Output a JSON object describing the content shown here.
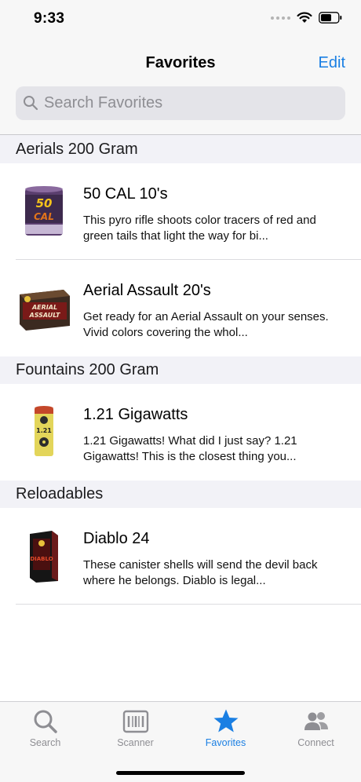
{
  "status": {
    "time": "9:33"
  },
  "nav": {
    "title": "Favorites",
    "edit_label": "Edit"
  },
  "search": {
    "placeholder": "Search Favorites"
  },
  "sections": [
    {
      "header": "Aerials 200 Gram",
      "items": [
        {
          "title": "50 CAL 10's",
          "description": "This pyro rifle shoots color tracers of red and green tails that light the way for bi...",
          "thumb_text": "50 CAL"
        },
        {
          "title": "Aerial Assault 20's",
          "description": "Get ready for an Aerial Assault on your senses. Vivid colors covering the whol...",
          "thumb_text": "AERIAL ASSAULT"
        }
      ]
    },
    {
      "header": "Fountains 200 Gram",
      "items": [
        {
          "title": "1.21 Gigawatts",
          "description": "1.21 Gigawatts! What did I just say? 1.21 Gigawatts! This is the closest thing you...",
          "thumb_text": "1.21"
        }
      ]
    },
    {
      "header": "Reloadables",
      "items": [
        {
          "title": "Diablo 24",
          "description": "These canister shells will send the devil back where he belongs.  Diablo is legal...",
          "thumb_text": "DIABLO"
        }
      ]
    }
  ],
  "tabs": [
    {
      "label": "Search",
      "icon": "magnifier-icon",
      "active": false
    },
    {
      "label": "Scanner",
      "icon": "barcode-scanner-icon",
      "active": false
    },
    {
      "label": "Favorites",
      "icon": "star-icon",
      "active": true
    },
    {
      "label": "Connect",
      "icon": "people-icon",
      "active": false
    }
  ],
  "colors": {
    "accent": "#1a7fe3",
    "inactive": "#8e8e93"
  }
}
